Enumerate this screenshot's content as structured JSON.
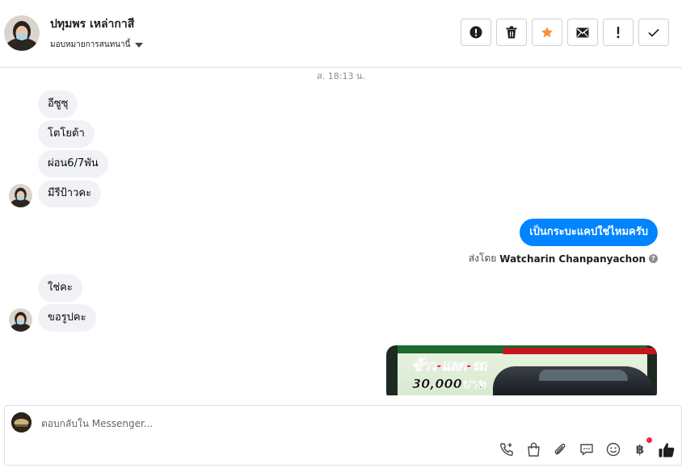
{
  "header": {
    "contact_name": "ปทุมพร เหล่ากาสี",
    "assign_label": "มอบหมายการสนทนานี้",
    "actions": [
      {
        "icon": "alert-circle-icon"
      },
      {
        "icon": "trash-icon"
      },
      {
        "icon": "star-icon"
      },
      {
        "icon": "envelope-icon"
      },
      {
        "icon": "exclamation-icon"
      },
      {
        "icon": "checkmark-icon"
      }
    ]
  },
  "conversation": {
    "timestamp": "ส. 18:13 น.",
    "incoming_group_1": [
      "อีซูซุ",
      "โตโยต้า",
      "ผ่อน6/7พัน",
      "มีรีป้าวคะ"
    ],
    "outgoing_message": "เป็นกระบะแคปใช่ไหมครับ",
    "sent_by_label": "ส่งโดย",
    "sent_by_name": "Watcharin Chanpanyachon",
    "incoming_group_2": [
      "ใช่คะ",
      "ขอรูปคะ"
    ],
    "photo": {
      "headline": "ข้าว-แลก-รถ",
      "price": "30,000บาท"
    }
  },
  "composer": {
    "placeholder": "ตอบกลับใน Messenger...",
    "tools": [
      "phone-plus-icon",
      "shopping-bag-icon",
      "paperclip-icon",
      "chat-bubble-icon",
      "smiley-icon",
      "baht-icon",
      "thumbs-up-icon"
    ],
    "baht_symbol": "฿"
  },
  "colors": {
    "outgoing_bubble": "#0084ff",
    "incoming_bubble": "#f0f2f5",
    "star": "#f7923a"
  }
}
